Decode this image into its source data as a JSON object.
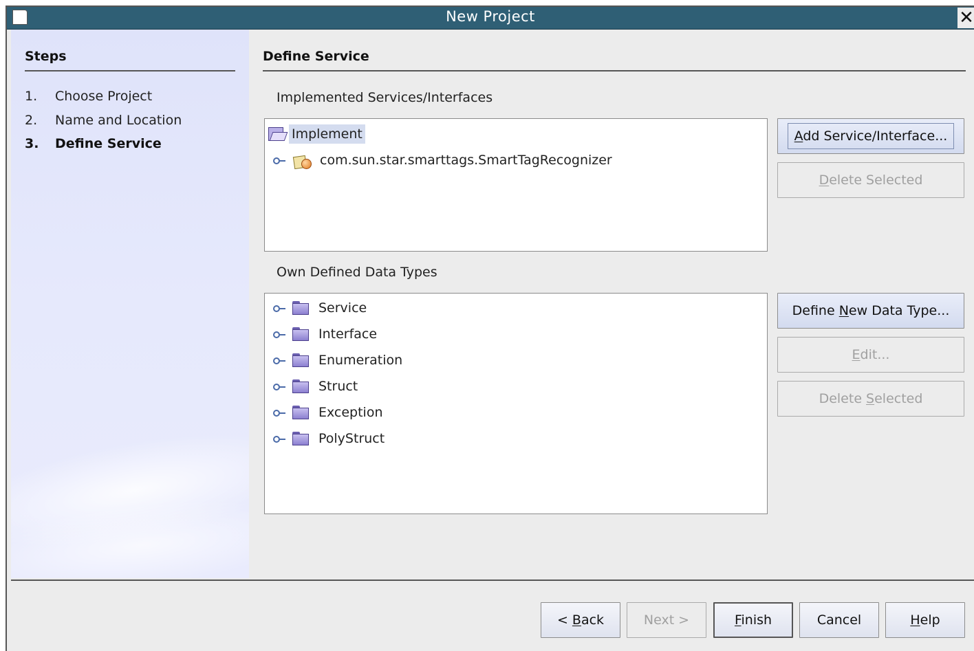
{
  "window": {
    "title": "New Project",
    "close_glyph": "✕"
  },
  "steps": {
    "heading": "Steps",
    "items": [
      {
        "num": "1.",
        "label": "Choose Project",
        "current": false
      },
      {
        "num": "2.",
        "label": "Name and Location",
        "current": false
      },
      {
        "num": "3.",
        "label": "Define Service",
        "current": true
      }
    ]
  },
  "main": {
    "section_title": "Define Service",
    "implemented": {
      "label": "Implemented Services/Interfaces",
      "root_label": "Implement",
      "children": [
        "com.sun.star.smarttags.SmartTagRecognizer"
      ],
      "buttons": {
        "add": {
          "pre": "",
          "mnemonic": "A",
          "post": "dd Service/Interface..."
        },
        "delete": {
          "pre": "",
          "mnemonic": "D",
          "post": "elete Selected"
        }
      }
    },
    "own_types": {
      "label": "Own Defined Data Types",
      "items": [
        "Service",
        "Interface",
        "Enumeration",
        "Struct",
        "Exception",
        "PolyStruct"
      ],
      "buttons": {
        "define": {
          "pre": "Define ",
          "mnemonic": "N",
          "post": "ew Data Type..."
        },
        "edit": {
          "pre": "",
          "mnemonic": "E",
          "post": "dit..."
        },
        "delete": {
          "pre": "Delete ",
          "mnemonic": "S",
          "post": "elected"
        }
      }
    }
  },
  "footer": {
    "back": {
      "pre": "< ",
      "mnemonic": "B",
      "post": "ack"
    },
    "next": {
      "label": "Next >"
    },
    "finish": {
      "pre": "",
      "mnemonic": "F",
      "post": "inish"
    },
    "cancel": {
      "label": "Cancel"
    },
    "help": {
      "pre": "",
      "mnemonic": "H",
      "post": "elp"
    }
  },
  "colors": {
    "title_bar": "#2f5f75",
    "steps_panel": "#e3e6fb",
    "selection": "#d4dcef"
  }
}
